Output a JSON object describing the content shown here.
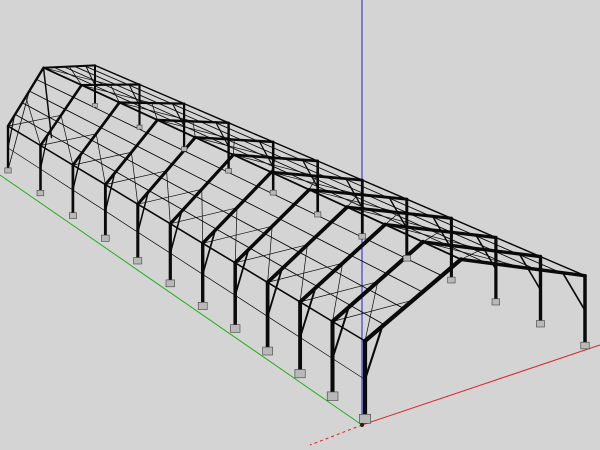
{
  "viewport": {
    "background": "#d4d4d4",
    "steel_color": "#0a0a0a",
    "footing_color": "#b8b8b8"
  },
  "axes": {
    "x_axis_color": "#e02020",
    "y_axis_color": "#20b020",
    "z_axis_color": "#2020e0",
    "origin_marker": "origin-icon"
  },
  "model": {
    "description_icon": "steel-frame-warehouse-icon",
    "bays": 11,
    "frames": 12
  }
}
